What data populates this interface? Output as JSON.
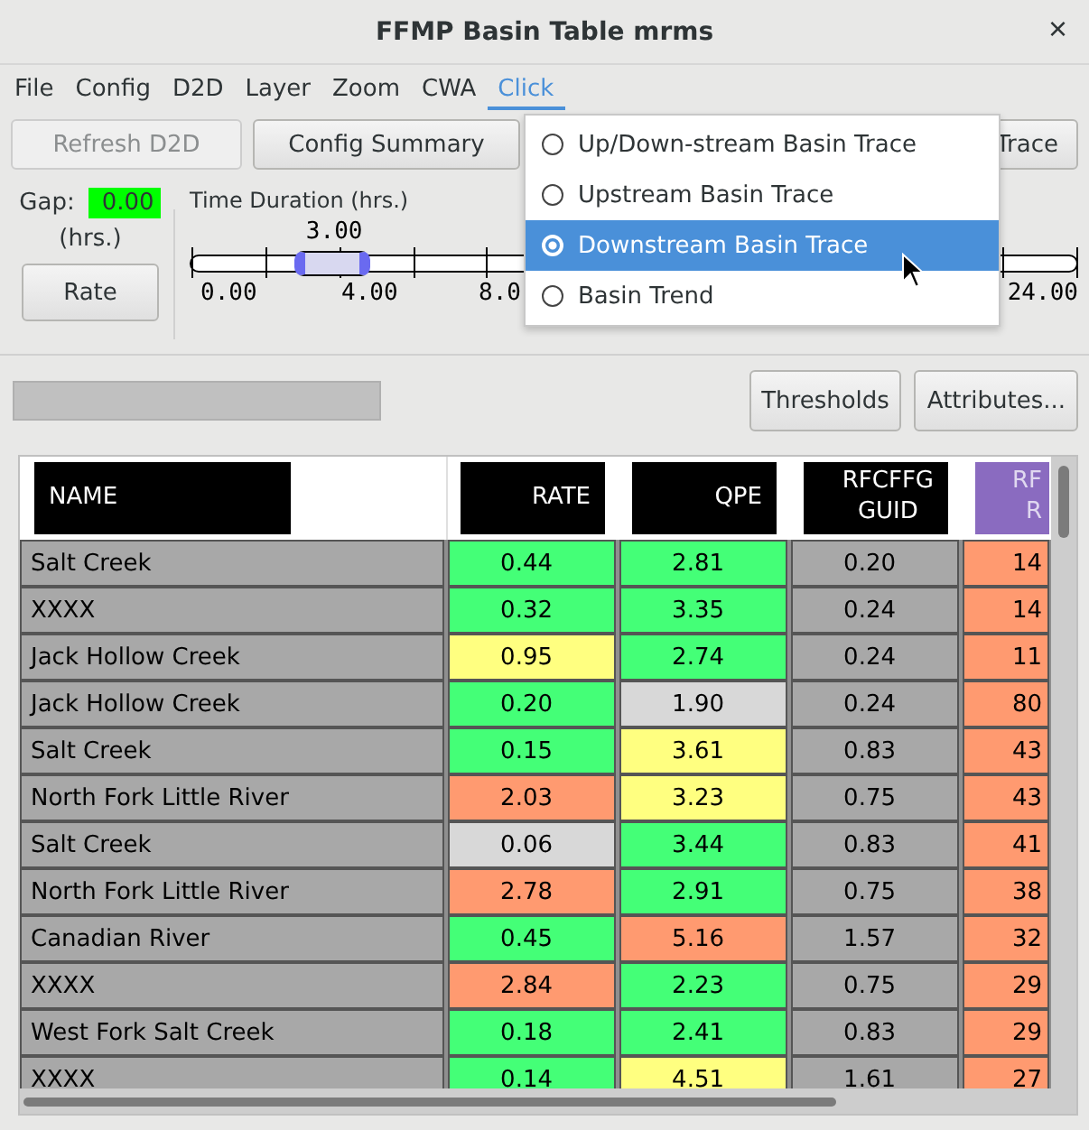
{
  "window": {
    "title": "FFMP Basin Table mrms",
    "close": "×"
  },
  "menu": [
    {
      "label": "File",
      "selected": false
    },
    {
      "label": "Config",
      "selected": false
    },
    {
      "label": "D2D",
      "selected": false
    },
    {
      "label": "Layer",
      "selected": false
    },
    {
      "label": "Zoom",
      "selected": false
    },
    {
      "label": "CWA",
      "selected": false
    },
    {
      "label": "Click",
      "selected": true
    }
  ],
  "toolbar": [
    {
      "label": "Refresh D2D",
      "disabled": true
    },
    {
      "label": "Config Summary",
      "disabled": false
    },
    {
      "label": "Trace",
      "disabled": false
    }
  ],
  "gap": {
    "label": "Gap:",
    "value": "0.00",
    "unit": "(hrs.)",
    "button": "Rate"
  },
  "duration": {
    "label": "Time Duration (hrs.)",
    "reading": "3.00",
    "level": 0.16,
    "ticks": [
      "0.00",
      "4.00",
      "8.0",
      "24.00"
    ]
  },
  "dropdown": [
    {
      "label": "Up/Down-stream Basin Trace",
      "selected": false
    },
    {
      "label": "Upstream Basin Trace",
      "selected": false
    },
    {
      "label": "Downstream Basin Trace",
      "selected": true
    },
    {
      "label": "Basin Trend",
      "selected": false
    }
  ],
  "progress": {
    "level": 0
  },
  "actions": [
    "Thresholds",
    "Attributes..."
  ],
  "table": {
    "columns": [
      "NAME",
      "RATE",
      "QPE",
      "RFCFFG\nGUID",
      "RF\nR"
    ],
    "rows": [
      {
        "cells": [
          {
            "text": "Salt Creek",
            "color": "#a8a8a8"
          },
          {
            "text": "0.44",
            "color": "#44ff77"
          },
          {
            "text": "2.81",
            "color": "#44ff77"
          },
          {
            "text": "0.20",
            "color": "#a8a8a8"
          },
          {
            "text": "14",
            "color": "#ff9a70"
          }
        ]
      },
      {
        "cells": [
          {
            "text": "XXXX",
            "color": "#a8a8a8"
          },
          {
            "text": "0.32",
            "color": "#44ff77"
          },
          {
            "text": "3.35",
            "color": "#44ff77"
          },
          {
            "text": "0.24",
            "color": "#a8a8a8"
          },
          {
            "text": "14",
            "color": "#ff9a70"
          }
        ]
      },
      {
        "cells": [
          {
            "text": "Jack Hollow Creek",
            "color": "#a8a8a8"
          },
          {
            "text": "0.95",
            "color": "#ffff80"
          },
          {
            "text": "2.74",
            "color": "#44ff77"
          },
          {
            "text": "0.24",
            "color": "#a8a8a8"
          },
          {
            "text": "11",
            "color": "#ff9a70"
          }
        ]
      },
      {
        "cells": [
          {
            "text": "Jack Hollow Creek",
            "color": "#a8a8a8"
          },
          {
            "text": "0.20",
            "color": "#44ff77"
          },
          {
            "text": "1.90",
            "color": "#d8d8d8"
          },
          {
            "text": "0.24",
            "color": "#a8a8a8"
          },
          {
            "text": "80",
            "color": "#ff9a70"
          }
        ]
      },
      {
        "cells": [
          {
            "text": "Salt Creek",
            "color": "#a8a8a8"
          },
          {
            "text": "0.15",
            "color": "#44ff77"
          },
          {
            "text": "3.61",
            "color": "#ffff80"
          },
          {
            "text": "0.83",
            "color": "#a8a8a8"
          },
          {
            "text": "43",
            "color": "#ff9a70"
          }
        ]
      },
      {
        "cells": [
          {
            "text": "North Fork Little River",
            "color": "#a8a8a8"
          },
          {
            "text": "2.03",
            "color": "#ff9a70"
          },
          {
            "text": "3.23",
            "color": "#ffff80"
          },
          {
            "text": "0.75",
            "color": "#a8a8a8"
          },
          {
            "text": "43",
            "color": "#ff9a70"
          }
        ]
      },
      {
        "cells": [
          {
            "text": "Salt Creek",
            "color": "#a8a8a8"
          },
          {
            "text": "0.06",
            "color": "#d8d8d8"
          },
          {
            "text": "3.44",
            "color": "#44ff77"
          },
          {
            "text": "0.83",
            "color": "#a8a8a8"
          },
          {
            "text": "41",
            "color": "#ff9a70"
          }
        ]
      },
      {
        "cells": [
          {
            "text": "North Fork Little River",
            "color": "#a8a8a8"
          },
          {
            "text": "2.78",
            "color": "#ff9a70"
          },
          {
            "text": "2.91",
            "color": "#44ff77"
          },
          {
            "text": "0.75",
            "color": "#a8a8a8"
          },
          {
            "text": "38",
            "color": "#ff9a70"
          }
        ]
      },
      {
        "cells": [
          {
            "text": "Canadian River",
            "color": "#a8a8a8"
          },
          {
            "text": "0.45",
            "color": "#44ff77"
          },
          {
            "text": "5.16",
            "color": "#ff9a70"
          },
          {
            "text": "1.57",
            "color": "#a8a8a8"
          },
          {
            "text": "32",
            "color": "#ff9a70"
          }
        ]
      },
      {
        "cells": [
          {
            "text": "XXXX",
            "color": "#a8a8a8"
          },
          {
            "text": "2.84",
            "color": "#ff9a70"
          },
          {
            "text": "2.23",
            "color": "#44ff77"
          },
          {
            "text": "0.75",
            "color": "#a8a8a8"
          },
          {
            "text": "29",
            "color": "#ff9a70"
          }
        ]
      },
      {
        "cells": [
          {
            "text": "West Fork Salt Creek",
            "color": "#a8a8a8"
          },
          {
            "text": "0.18",
            "color": "#44ff77"
          },
          {
            "text": "2.41",
            "color": "#44ff77"
          },
          {
            "text": "0.83",
            "color": "#a8a8a8"
          },
          {
            "text": "29",
            "color": "#ff9a70"
          }
        ]
      },
      {
        "cells": [
          {
            "text": "XXXX",
            "color": "#a8a8a8"
          },
          {
            "text": "0.14",
            "color": "#44ff77"
          },
          {
            "text": "4.51",
            "color": "#ffff80"
          },
          {
            "text": "1.61",
            "color": "#a8a8a8"
          },
          {
            "text": "27",
            "color": "#ff9a70"
          }
        ]
      }
    ]
  }
}
